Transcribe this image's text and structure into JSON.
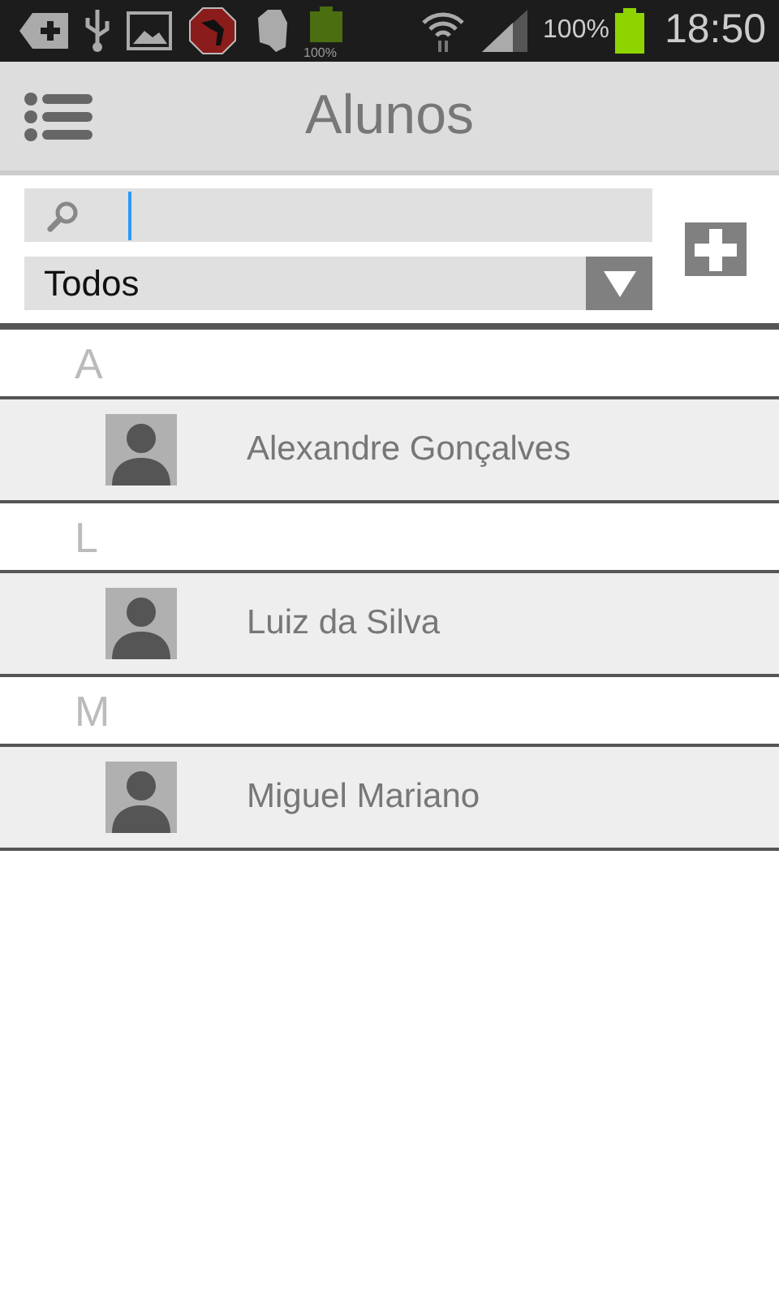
{
  "status_bar": {
    "notification_battery_text": "100%",
    "battery_percent": "100%",
    "time": "18:50"
  },
  "header": {
    "title": "Alunos"
  },
  "filter": {
    "value": "Todos"
  },
  "sections": [
    {
      "letter": "A",
      "students": [
        {
          "name": "Alexandre Gonçalves"
        }
      ]
    },
    {
      "letter": "L",
      "students": [
        {
          "name": "Luiz da Silva"
        }
      ]
    },
    {
      "letter": "M",
      "students": [
        {
          "name": "Miguel Mariano"
        }
      ]
    }
  ]
}
